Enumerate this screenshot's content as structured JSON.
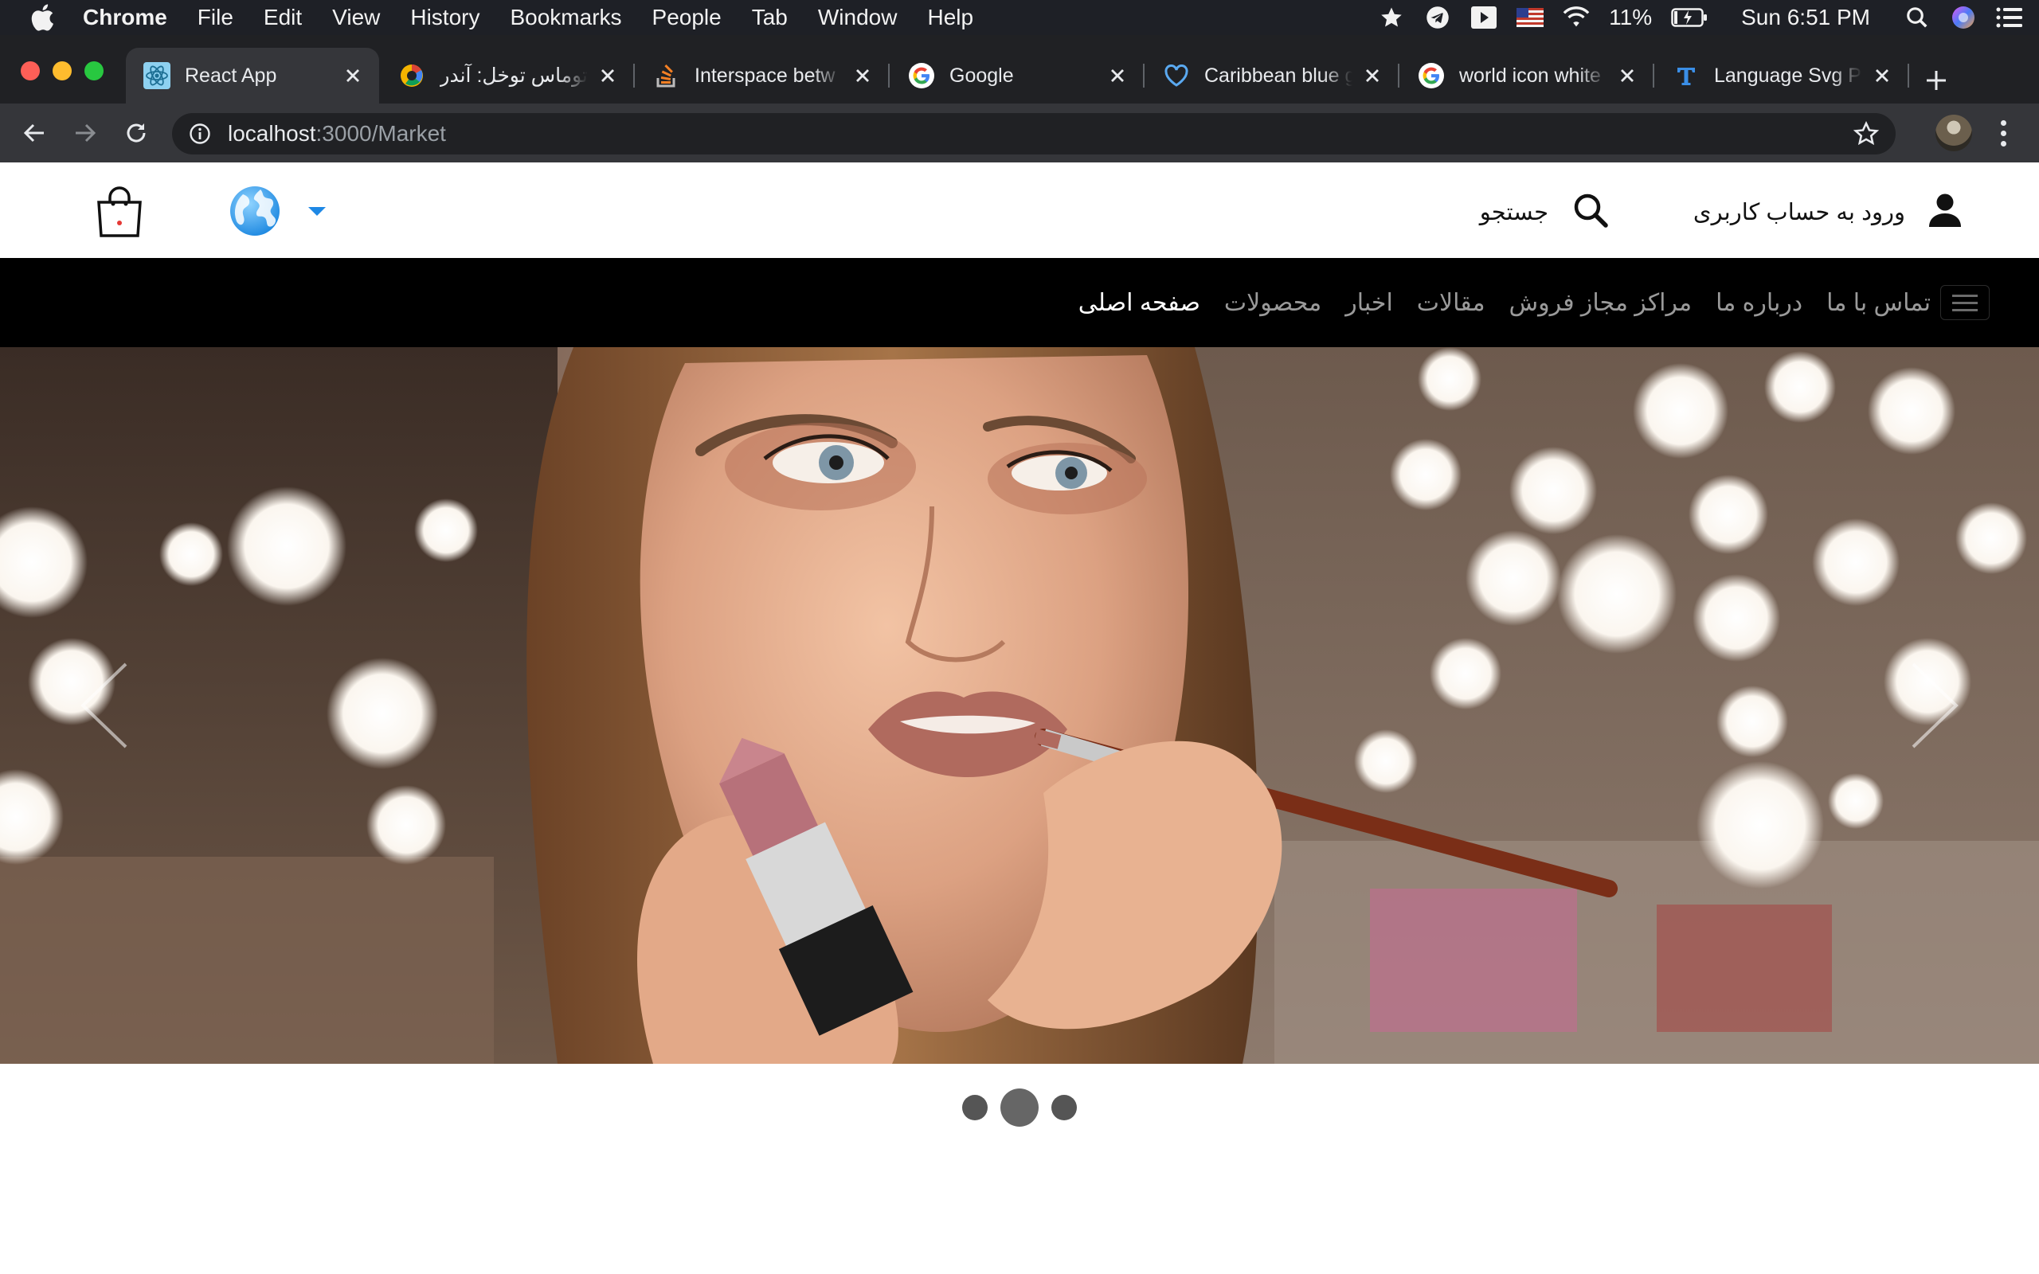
{
  "menubar": {
    "app": "Chrome",
    "items": [
      "File",
      "Edit",
      "View",
      "History",
      "Bookmarks",
      "People",
      "Tab",
      "Window",
      "Help"
    ],
    "battery": "11%",
    "clock": "Sun 6:51 PM"
  },
  "tabs": [
    {
      "title": "React App",
      "icon": "react-icon"
    },
    {
      "title": "توماس توخل: آندر ه",
      "icon": "news-favicon"
    },
    {
      "title": "Interspace betw",
      "icon": "stackoverflow-icon"
    },
    {
      "title": "Google",
      "icon": "google-icon"
    },
    {
      "title": "Caribbean blue g",
      "icon": "heart-icon"
    },
    {
      "title": "world icon white",
      "icon": "google-icon"
    },
    {
      "title": "Language Svg Pr",
      "icon": "t-favicon"
    }
  ],
  "address": {
    "host": "localhost",
    "path": ":3000/Market"
  },
  "site": {
    "search_label": "جستجو",
    "login_label": "ورود به حساب کاربری",
    "nav": [
      "صفحه اصلی",
      "محصولات",
      "اخبار",
      "مقالات",
      "مراکز مجاز فروش",
      "درباره ما",
      "تماس با ما"
    ],
    "active_nav": "صفحه اصلی"
  },
  "carousel": {
    "slides": 3,
    "active_index": 1
  },
  "colors": {
    "menubar_bg": "#1e2026",
    "tabstrip_bg": "#202124",
    "toolbar_bg": "#35363a",
    "navbar_bg": "#000000",
    "accent_blue": "#1e88e5"
  }
}
